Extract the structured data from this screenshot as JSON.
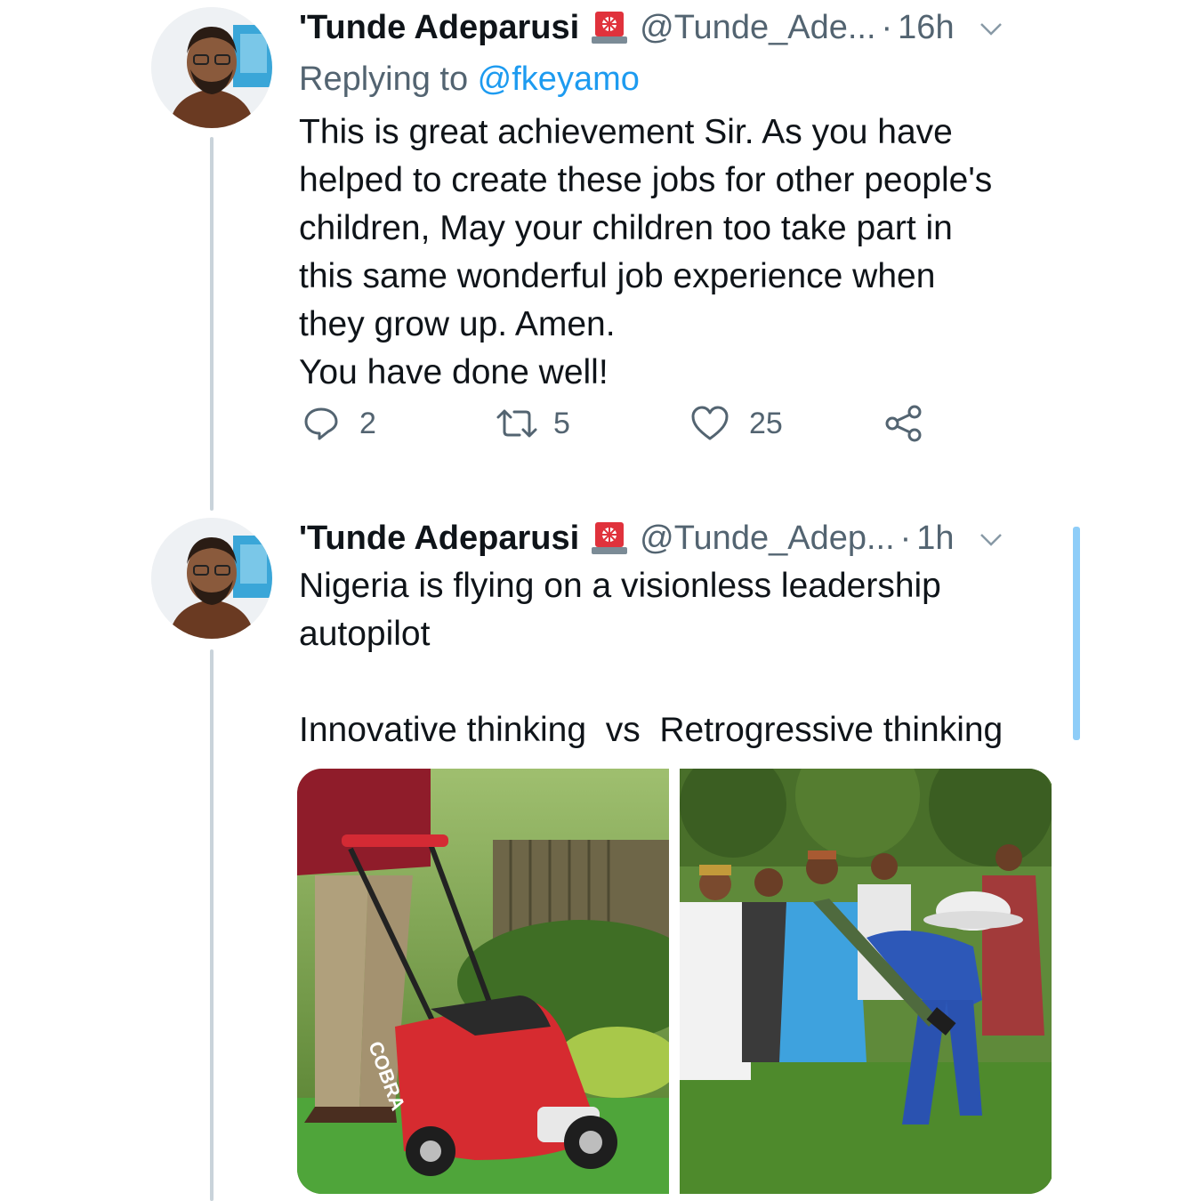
{
  "tweets": [
    {
      "display_name": "'Tunde Adeparusi",
      "badge": "emergency-light-icon",
      "handle": "@Tunde_Ade...",
      "separator": "·",
      "time": "16h",
      "replying_prefix": "Replying to ",
      "replying_to": "@fkeyamo",
      "lines": [
        "This is great achievement Sir. As you have",
        "helped to create these jobs for other people's",
        "children, May your children too take part in",
        "this same wonderful job experience when",
        "they grow up. Amen.",
        "You have done well!"
      ],
      "actions": {
        "reply_count": "2",
        "retweet_count": "5",
        "like_count": "25"
      }
    },
    {
      "display_name": "'Tunde Adeparusi",
      "badge": "emergency-light-icon",
      "handle": "@Tunde_Adep...",
      "separator": "·",
      "time": "1h",
      "lines": [
        "Nigeria is flying on a visionless leadership",
        "autopilot",
        "",
        "Innovative thinking  vs  Retrogressive thinking"
      ],
      "media": [
        {
          "alt_icon": "lawnmower-photo",
          "mower_brand": "COBRA"
        },
        {
          "alt_icon": "men-with-cutlass-photo"
        }
      ]
    }
  ],
  "colors": {
    "text": "#0f1419",
    "secondary": "#536471",
    "link": "#1d9bf0",
    "thread_line": "#c9d3da",
    "scroll": "#8ecdf8"
  }
}
